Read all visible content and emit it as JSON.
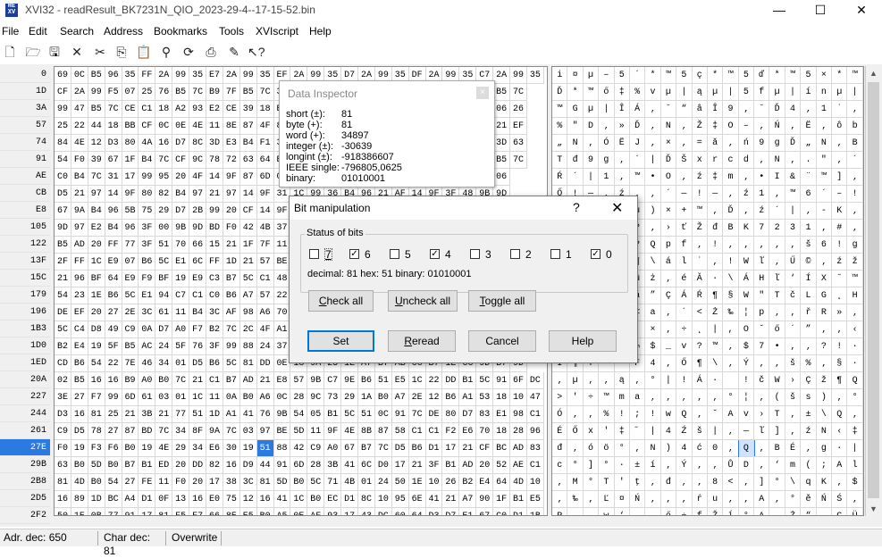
{
  "window": {
    "title": "XVI32 - readResult_BK7231N_QIO_2023-29-4--17-15-52.bin",
    "minimize": "—",
    "maximize": "☐",
    "close": "✕"
  },
  "menu": [
    "File",
    "Edit",
    "Search",
    "Address",
    "Bookmarks",
    "Tools",
    "XVIscript",
    "Help"
  ],
  "offsets": [
    "0",
    "1D",
    "3A",
    "57",
    "74",
    "91",
    "AE",
    "CB",
    "E8",
    "105",
    "122",
    "13F",
    "15C",
    "179",
    "196",
    "1B3",
    "1D0",
    "1ED",
    "20A",
    "227",
    "244",
    "261",
    "27E",
    "29B",
    "2B8",
    "2D5",
    "2F2"
  ],
  "selected_row": 22,
  "hex_rows": [
    "69 0C B5 96 35 FF 2A 99 35 E7 2A 99 35 EF 2A 99 35 D7 2A 99 35 DF 2A 99 35 C7 2A 99 35",
    "CF 2A 99 F5 07 25 76 B5 7C B9 7F B5 7C 37 77 B5 7C 3F 77 B5 7C 5F 77 B5 7C 5F B5 7C",
    "99 47 B5 7C CE C1 18 A2 93 E2 CE 39 18 ED 67 5C 16 18 B5 B4 00 A3 1E D1 F2 5F 06 26",
    "25 22 44 18 BB CF 0C 0E 4E 11 8E 87 4F 84 D1 E2 99 8E 31 D4 FC C9 A3 F0 CE 3A 21 EF",
    "84 4E 12 D3 80 4A 16 D7 8C 3D E3 B4 F1 33 E8 96 28 D3 10 AC 0B 3A 24 66 51 8D 3D 63",
    "54 F0 39 67 1F B4 7C CF 9C 78 72 63 64 E2 A1 0A 2E 22 12 B4 3E 67 A7 1A 54 47 B5 7C",
    "C0 B4 7C 31 17 99 95 20 4F 14 9F 87 6D 0E 95 49 26 A8 99 5D 20 1E C7 59 95 99 06",
    "D5 21 97 14 9F 80 82 B4 97 21 97 14 9F 31 1C 99 36 B4 96 21 AF 14 9F 3F 48 9B 9D",
    "67 9A B4 96 5B 75 29 D7 2B 99 20 CF 14 9F B4 7C 17 2D 4B 14 97 7D 2F 61 96 29 93",
    "9D 97 E2 B4 96 3F 00 9B 9D BD F0 42 4B 37 2C 37 31 00 00 23 00 00 00 00 00 00 00",
    "B5 AD 20 FF 77 3F 51 70 66 15 21 1F 7F 11 86 0A 9A 36 21 67 D3 99 11 FF 00 00 00",
    "2F FF 1C E9 07 B6 5C E1 6C FF 1D 21 57 BE 19 DB A9 0D 9F 9E 1F 51 C0 7D 45 FE 21",
    "21 96 BF 64 E9 F9 BF 19 E9 C3 B7 5C C1 48 BE 91 CD 58 A2 99 A0 CF 7F 62 05 93 23",
    "54 23 1E B6 5C E1 94 C7 C1 C0 B6 A7 57 22 54 E8 4C 47 B2 48 7C 20 46 C5 F3 7C",
    "DE EF 20 27 2E 3C 61 11 B4 3C AF 98 A6 70 13 1F F8 52 BB 90 3E 2D 60 BE 05 27 2E",
    "5C C4 D8 49 C9 0A D7 A0 F7 B2 7C 2C 4F A1 F5 B4 94 1E 18 8F 4B 4E C1 52 F5 46",
    "B2 E4 19 5F B5 AC 24 5F 76 3F 99 88 24 37 95 98 1B 3F 21 B7 6C F4 93 37 16 B8",
    "CD B6 54 22 7E 46 34 01 D5 B6 5C 81 DD 0E 18 9A 25 1E A7 B7 AB CC B7 1E CC 9D B7 9D",
    "02 B5 16 16 B9 A0 B0 7C 21 C1 B7 AD 21 E8 57 9B C7 9E B6 51 E5 1C 22 DD B1 5C 91 6F DC",
    "3E 27 F7 99 6D 61 03 01 1C 11 0A B0 A6 0C 28 9C 73 29 1A B0 A7 2E 12 B6 A1 53 18 10 47",
    "D3 16 81 25 21 3B 21 77 51 1D A1 41 76 9B 54 05 B1 5C 51 0C 91 7C DE 80 D7 83 E1 98 C1",
    "C9 D5 78 27 87 BD 7C 34 8F 9A 7C 03 97 BE 5D 11 9F 4E 8B 87 58 C1 C1 F2 E6 70 18 28 96",
    "F0 19 F3 F6 B0 19 4E 29 34 E6 30 19 51 88 42 C9 A0 67 B7 7C D5 B6 D1 17 21 CF BC AD 83",
    "63 B0 5D B0 B7 B1 ED 20 DD 82 16 D9 44 91 6D 28 3B 41 6C D0 17 21 3F B1 AD 20 52 AE C1",
    "81 4D B0 54 27 FE 11 F0 20 17 38 3C 81 5D B0 5C 71 4B 01 24 50 1E 10 26 B2 E4 64 4D 10",
    "16 89 1D BC A4 D1 0F 13 16 E0 75 12 16 41 1C B0 EC D1 8C 10 95 6E 41 21 A7 90 1F B1 E5",
    "50 1E 0B 77 91 17 81 F5 F7 66 8E E5 B0 A5 0E AF 93 17 43 DC 60 64 D3 D7 E1 67 C0 D1 1B"
  ],
  "hex_selected_col": 12,
  "text_rows": [
    "i ¤ µ – 5 ´ * ™ 5 ç * ™ 5 ď * ™ 5 × * ™ 5 ß * ™ 5 Ç * ™ 5",
    "Ď * ™ ő ‡ % v µ | ą µ | 5 f µ | í n µ | | V µ | _ µ |",
    "™ G µ | Î Á ‚ ˘ “ â Î 9 ‚ ˘ Ď 4 ‚ 1 ˙ ‚ Ş ‚ y u – ß _ ‚ &",
    "% \" D ‚ » Ď ‚ N ‚ Ž ‡ O – ‚ Ń ‚ Ë ‚ ô b ő Î : ! ď",
    "„ N ‚ Ó Ë J ‚ × ‚ = ă ‚ ń 9 g Ď „ N ‚ B ‚ 3 ‚ J ‚ 7 Ť = c",
    "T đ 9 g ‚ ´ | Ď Š x r c d ‚ N ‚ . \" ‚ ´ > g § ‚ T G µ |",
    "Ŕ ´ | 1 ‚ ™ • O ‚ ź ‡ m ‚ • I & ¨ ™ ] ‚ ‚ Ç Y • ™ ‚",
    "Ő ! — ‚ ź ‚ ‚ ´ — ! — ‚ ź 1 ‚ ™ 6 ´ – ! Ż ‚ ź ? H › ť",
    "g š ´ – [ u ) × + ™ ‚ Ď ‚ ź ´ | ‚ - K ‚ — } / a – ) “",
    "ť — â ´ – ? ‚ › ť Ž đ B K 7 2 3 1 ‚ # ‚ ‚ ‚ ‚ ‚ ‚ ‚",
    "µ ­ ‚ ˙ w ? Q p f ‚ ! ‚ ‚ ‚ ‚ ‚ š 6 ! g Ó ™ ‚ ˙ ‚ ‚ ‚",
    "/ ˙ ‚ é ‚ ¶ \\ á l ˙ ‚ ! W ľ ‚ Ű © ‚ ź ž ‚ Q Ŕ } E ţ !",
    "! – ż d é ů ż ‚ é Ă · \\ Á H ľ ‘ Í X ˘ ™ ‚ Ď ‚ b ‚ “ #",
    "T # ‚ ¶ \\ á ” Ç Á Ŕ ¶ § W \" T č L G ˛ H | ‚ F Ĺ ó |",
    "Ţ ď ‚ ' . < a ‚ ´ < Ż ‰ ¦ p ‚ ‚ ř R » ‚ > - ` ľ ‚ ' .",
    "\\ Ä Ř I É ‚ × ‚ ÷ ˛ | , O ˇ ő ´ ” ‚ ‚ ‹ K N Á R ő F",
    "˛ ä ‚ _ µ ¬ $ _ v ? ™ ‚ $ 7 • ‚ ‚ ? ! · l ô “ 7 ‚ ¸",
    "Í ¶ T \" ~ F 4 ‚ Ő ¶ \\ ‚ Ý ‚ ‚ š % ‚ § · « Ě · ‚ Ě ť · ť",
    "‚ µ ‚ ‚ ą ‚ ° | ! Á · ­ ! č W › Ç ž ¶ Q ĺ ‚ \" Ý ± \\ ‘ o Ü",
    "> ' ÷ ™ m a ‚ ‚ ‚ ‚ ‚ ° ¦ ‚ ( š s ) ‚ ° § . ¶ ˇ S ‚ ‚ G",
    "Ó ‚ ‚ % ! ; ! w Q ‚ ˇ A v › T ‚ ± \\ Q ‚ ‘ | Ţ € × á Á",
    "É Ő x ' ‡ ˝ | 4 Ź š | ‚ — ľ ] ‚ ź N ‹ ‡ X Á Á ň ć p ‚ ( –",
    "đ ‚ ó ö ° ‚ N ) 4 ć 0 ‚ Q ‚ B É ‚ g · | Ő ¶ Ń ‚ ! Ď Ľ –",
    "c ° ] ° · ± í ‚ Ý ‚ ‚ Ů D ‚ ‘ m ( ; A l Đ ‚ ! ? ± ‚ R ® Á",
    "‚ M ° T ' ţ ‚ đ ‚ ‚ 8 < ‚ ] ° \\ q K ‚ $ P ‚ ‚ & ˛ ä d M ‚",
    "‚ ‰ ‚ Ľ ¤ Ń ‚ ‚ ‚ ŕ u ‚ ‚ A ‚ ° ě Ń Ś ‚ • n A ! § ‚ ‚ ą ĺ",
    "P ‚ ‚ w ‘ ‚ ‚ ő ÷ f Ž ĺ ° Ą ‚ Ż “ ‚ C Ü ` d Ó × á g Ŕ Ń ‚"
  ],
  "text_selected_col": 12,
  "inspector": {
    "title": "Data Inspector",
    "close": "×",
    "rows": [
      {
        "label": "short (±):",
        "value": "81"
      },
      {
        "label": "byte (+):",
        "value": "81"
      },
      {
        "label": "word (+):",
        "value": "34897"
      },
      {
        "label": "integer (±):",
        "value": "-30639"
      },
      {
        "label": "longint (±):",
        "value": "-918386607"
      },
      {
        "label": "IEEE single:",
        "value": "-796805,0625"
      },
      {
        "label": "binary:",
        "value": "01010001"
      }
    ]
  },
  "bitdlg": {
    "title": "Bit manipulation",
    "help_glyph": "?",
    "close_glyph": "✕",
    "group_label": "Status of bits",
    "bits": [
      {
        "label": "7",
        "checked": false
      },
      {
        "label": "6",
        "checked": true
      },
      {
        "label": "5",
        "checked": false
      },
      {
        "label": "4",
        "checked": true
      },
      {
        "label": "3",
        "checked": false
      },
      {
        "label": "2",
        "checked": false
      },
      {
        "label": "1",
        "checked": false
      },
      {
        "label": "0",
        "checked": true
      }
    ],
    "info": "decimal: 81  hex: 51  binary: 01010001",
    "check_all": "Check all",
    "uncheck_all": "Uncheck all",
    "toggle_all": "Toggle all",
    "set": "Set",
    "reread": "Reread",
    "cancel": "Cancel",
    "help": "Help"
  },
  "status": {
    "addr": "Adr. dec: 650",
    "char": "Char dec: 81",
    "mode": "Overwrite"
  },
  "colors": {
    "selection": "#2a7ae2",
    "accent": "#0078d7"
  }
}
